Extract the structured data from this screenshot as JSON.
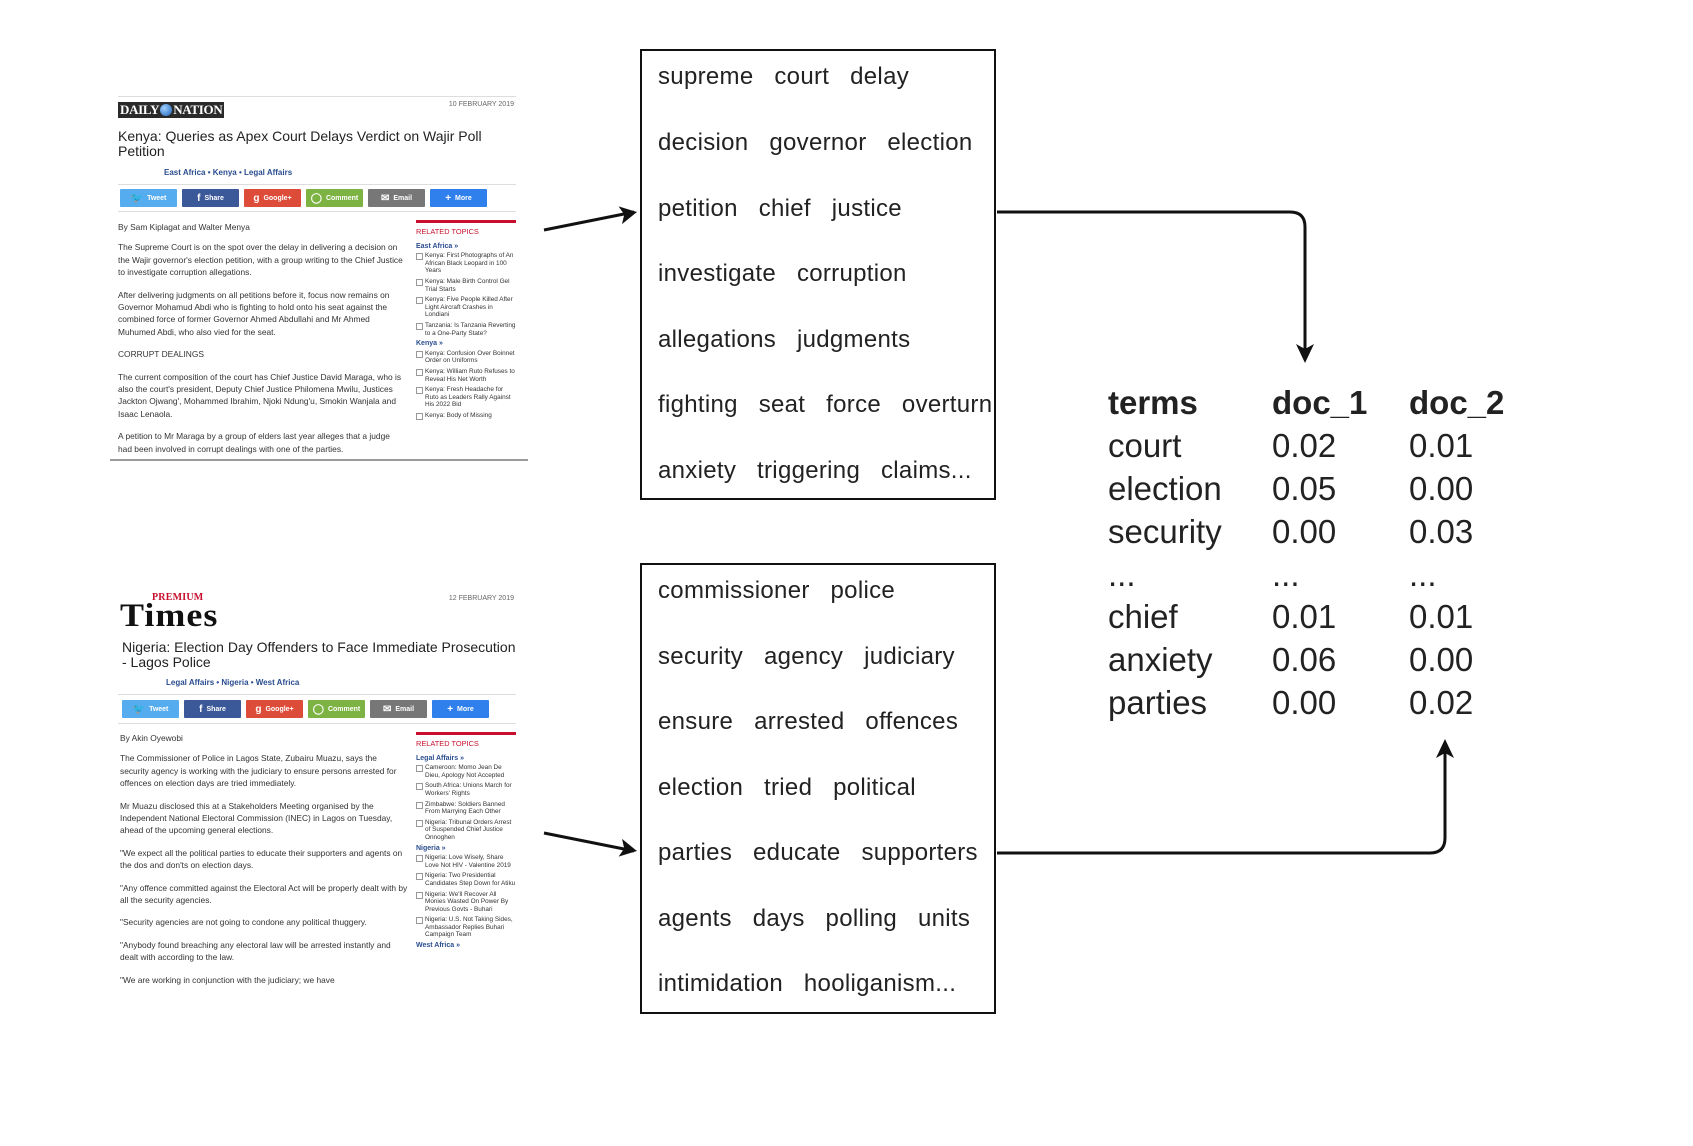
{
  "article1": {
    "logo": "DAILY NATION",
    "date": "10 FEBRUARY 2019",
    "headline": "Kenya: Queries as Apex Court Delays Verdict on Wajir Poll Petition",
    "categories": "East Africa  •  Kenya  •  Legal Affairs",
    "share_buttons": [
      "Tweet",
      "Share",
      "Google+",
      "Comment",
      "Email",
      "More"
    ],
    "byline": "By Sam Kiplagat and Walter Menya",
    "paragraphs": [
      "The Supreme Court is on the spot over the delay in delivering a decision on the Wajir governor's election petition, with a group writing to the Chief Justice to investigate corruption allegations.",
      "After delivering judgments on all petitions before it, focus now remains on Governor Mohamud Abdi who is fighting to hold onto his seat against the combined force of former Governor Ahmed Abdullahi and Mr Ahmed Muhumed Abdi, who also vied for the seat.",
      "CORRUPT DEALINGS",
      "The current composition of the court has Chief Justice David Maraga, who is also the court's president, Deputy Chief Justice Philomena Mwilu, Justices Jackton Ojwang', Mohammed Ibrahim, Njoki Ndung'u, Smokin Wanjala and Isaac Lenaola.",
      "A petition to Mr Maraga by a group of elders last year alleges that a judge had been involved in corrupt dealings with one of the parties."
    ],
    "related": {
      "title": "RELATED TOPICS",
      "sections": [
        {
          "name": "East Africa »",
          "items": [
            "Kenya: First Photographs of An African Black Leopard in 100 Years",
            "Kenya: Male Birth Control Gel Trial Starts",
            "Kenya: Five People Killed After Light Aircraft Crashes in Londiani",
            "Tanzania: Is Tanzania Reverting to a One-Party State?"
          ]
        },
        {
          "name": "Kenya »",
          "items": [
            "Kenya: Confusion Over Boinnet Order on Uniforms",
            "Kenya: William Ruto Refuses to Reveal His Net Worth",
            "Kenya: Fresh Headache for Ruto as Leaders Rally Against His 2022 Bid",
            "Kenya: Body of Missing"
          ]
        }
      ]
    }
  },
  "article2": {
    "logo_small": "PREMIUM",
    "logo": "Times",
    "date": "12 FEBRUARY 2019",
    "headline": "Nigeria: Election Day Offenders to Face Immediate Prosecution - Lagos Police",
    "categories": "Legal Affairs  •  Nigeria  •  West Africa",
    "share_buttons": [
      "Tweet",
      "Share",
      "Google+",
      "Comment",
      "Email",
      "More"
    ],
    "byline": "By Akin Oyewobi",
    "paragraphs": [
      "The Commissioner of Police in Lagos State, Zubairu Muazu, says the security agency is working with the judiciary to ensure persons arrested for offences on election days are tried immediately.",
      "Mr Muazu disclosed this at a Stakeholders Meeting organised by the Independent National Electoral Commission (INEC) in Lagos on Tuesday, ahead of the upcoming general elections.",
      "\"We expect all the political parties to educate their supporters and agents on the dos and don'ts on election days.",
      "\"Any offence committed against the Electoral Act will be properly dealt with by all the security agencies.",
      "\"Security agencies are not going to condone any political thuggery.",
      "\"Anybody found breaching any electoral law will be arrested instantly and dealt with according to the law.",
      "\"We are working in conjunction with the judiciary; we have"
    ],
    "related": {
      "title": "RELATED TOPICS",
      "sections": [
        {
          "name": "Legal Affairs »",
          "items": [
            "Cameroon: Momo Jean De Dieu, Apology Not Accepted",
            "South Africa: Unions March for Workers' Rights",
            "Zimbabwe: Soldiers Banned From Marrying Each Other",
            "Nigeria: Tribunal Orders Arrest of Suspended Chief Justice Onnoghen"
          ]
        },
        {
          "name": "Nigeria »",
          "items": [
            "Nigeria: Love Wisely, Share Love Not HIV - Valentine 2019",
            "Nigeria: Two Presidential Candidates Step Down for Atiku",
            "Nigeria: We'll Recover All Monies Wasted On Power By Previous Govts - Buhari",
            "Nigeria: U.S. Not Taking Sides, Ambassador Replies Buhari Campaign Team"
          ]
        },
        {
          "name": "West Africa »",
          "items": []
        }
      ]
    }
  },
  "words_doc1": [
    "supreme   court   delay",
    "decision   governor   election",
    "petition   chief   justice",
    "investigate   corruption",
    "allegations   judgments",
    "fighting   seat   force   overturn",
    "anxiety   triggering   claims..."
  ],
  "words_doc2": [
    "commissioner   police",
    "security   agency   judiciary",
    "ensure   arrested   offences",
    "election   tried   political",
    "parties   educate   supporters",
    "agents   days   polling   units",
    "intimidation   hooliganism..."
  ],
  "term_table": {
    "headers": [
      "terms",
      "doc_1",
      "doc_2"
    ],
    "rows": [
      [
        "court",
        "0.02",
        "0.01"
      ],
      [
        "election",
        "0.05",
        "0.00"
      ],
      [
        "security",
        "0.00",
        "0.03"
      ],
      [
        "...",
        "...",
        "..."
      ],
      [
        "chief",
        "0.01",
        "0.01"
      ],
      [
        "anxiety",
        "0.06",
        "0.00"
      ],
      [
        "parties",
        "0.00",
        "0.02"
      ]
    ]
  },
  "colors": {
    "arrow": "#111111",
    "box_border": "#111111",
    "related_red": "#c8102e",
    "link_blue": "#2a4d8f"
  }
}
